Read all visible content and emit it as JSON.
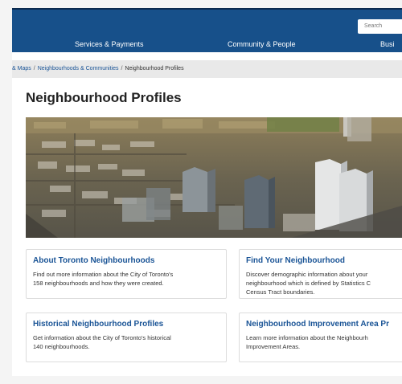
{
  "header": {
    "search_placeholder": "Search",
    "nav": [
      "Services & Payments",
      "Community & People",
      "Busi"
    ]
  },
  "breadcrumb": {
    "items": [
      "& Maps",
      "Neighbourhoods & Communities",
      "Neighbourhood Profiles"
    ],
    "separator": "/"
  },
  "page": {
    "title": "Neighbourhood Profiles"
  },
  "cards": [
    {
      "title": "About Toronto Neighbourhoods",
      "desc_lines": [
        "Find out more information about the City of Toronto's",
        "158 neighbourhoods and how they were created."
      ]
    },
    {
      "title": "Find Your Neighbourhood",
      "desc_lines": [
        "Discover demographic information about your",
        "neighbourhood which is defined by Statistics C",
        "Census Tract boundaries."
      ]
    },
    {
      "title": "Historical Neighbourhood Profiles",
      "desc_lines": [
        "Get information about the City of Toronto's historical",
        "140 neighbourhoods."
      ]
    },
    {
      "title": "Neighbourhood Improvement Area Pr",
      "desc_lines": [
        "Learn more information about the Neighbourh",
        "Improvement Areas."
      ]
    }
  ],
  "colors": {
    "header_bg": "#17508a",
    "link": "#1a5496",
    "breadcrumb_bg": "#e9e9e9"
  }
}
